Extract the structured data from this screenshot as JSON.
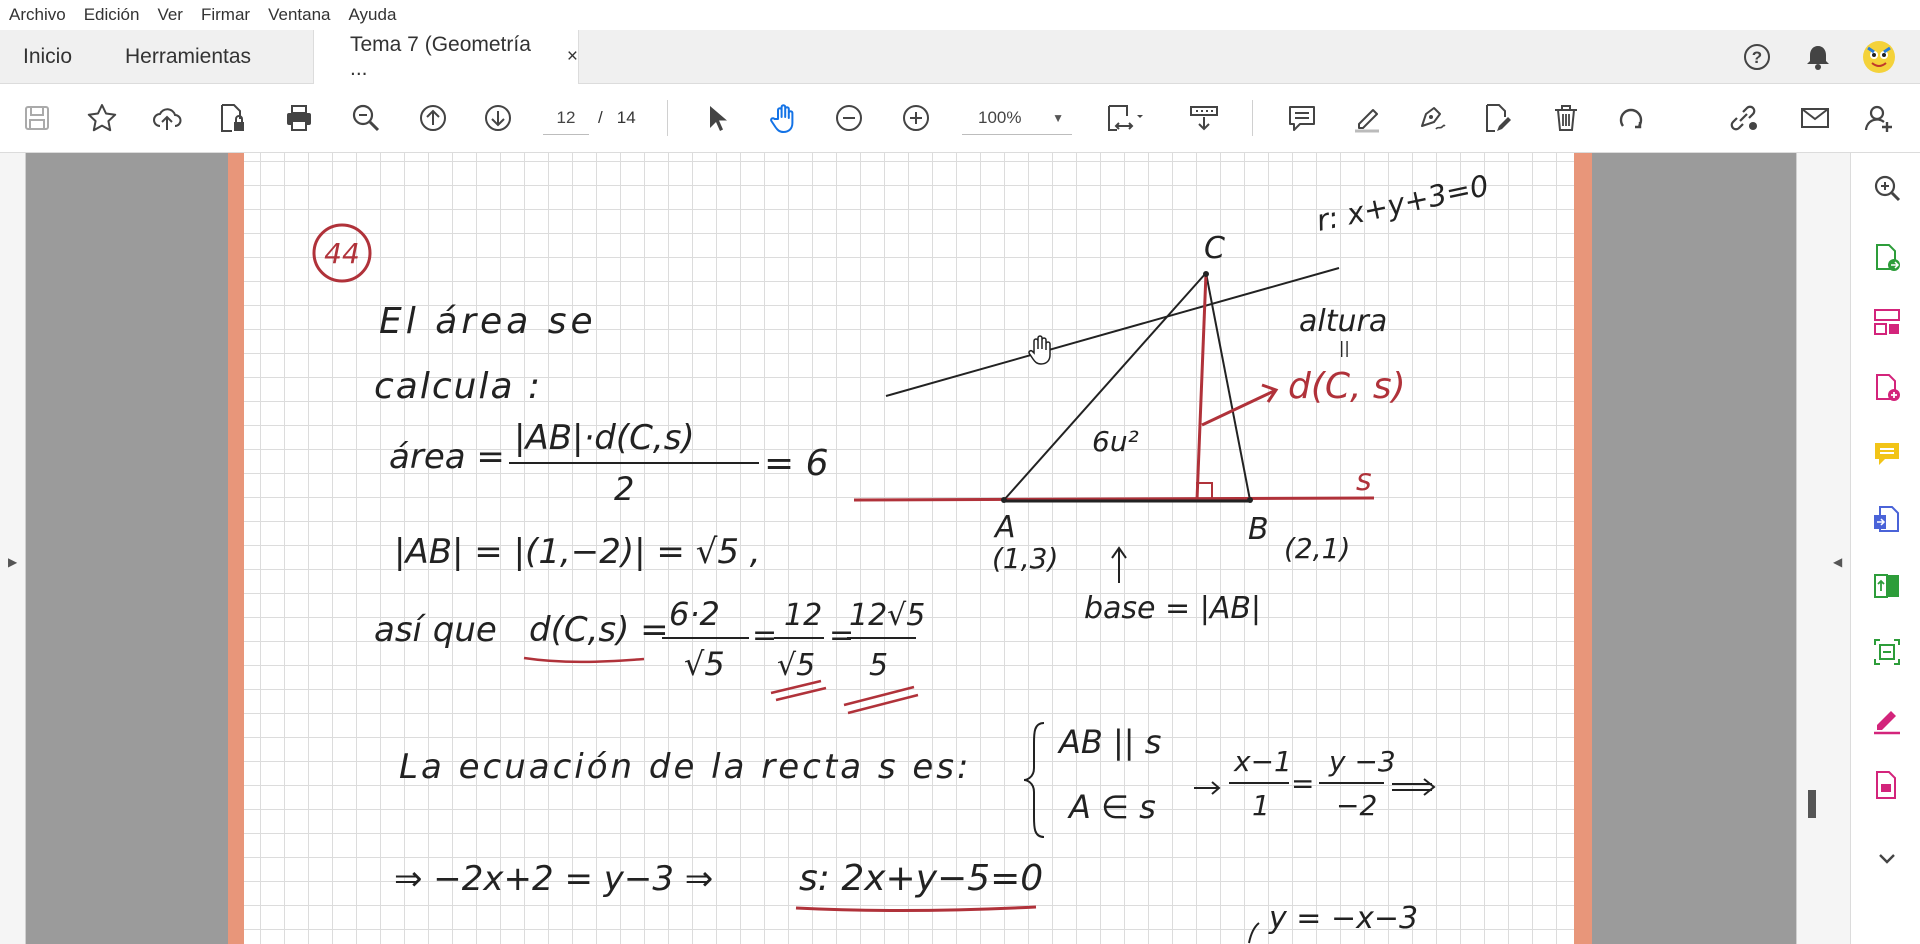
{
  "menu": [
    "Archivo",
    "Edición",
    "Ver",
    "Firmar",
    "Ventana",
    "Ayuda"
  ],
  "tabs": {
    "home": "Inicio",
    "tools": "Herramientas",
    "document": "Tema 7 (Geometría ...",
    "close": "×"
  },
  "toolbar": {
    "page_current": "12",
    "page_separator": "/",
    "page_total": "14",
    "zoom": "100%"
  },
  "colors": {
    "accent_blue": "#1473e6",
    "page_border": "#e8967a",
    "tool_purple": "#d3247b",
    "tool_green": "#2d9d3a"
  },
  "icons": {
    "toolbar": [
      "save-icon",
      "star-icon",
      "upload-cloud-icon",
      "lock-file-icon",
      "print-icon",
      "zoom-search-icon",
      "page-up-icon",
      "page-down-icon",
      "pointer-icon",
      "hand-icon",
      "zoom-out-icon",
      "zoom-in-icon",
      "fit-page-icon",
      "scroll-mode-icon",
      "comment-icon",
      "highlight-icon",
      "sign-icon",
      "edit-file-icon",
      "delete-icon",
      "rotate-icon",
      "link-icon",
      "email-icon",
      "add-user-icon"
    ],
    "right_panel": [
      "search-zoom-icon",
      "export-pdf-icon",
      "organize-pages-icon",
      "create-pdf-icon",
      "comment-tool-icon",
      "combine-files-icon",
      "compress-icon",
      "scan-icon",
      "fill-sign-icon",
      "edit-pdf-icon",
      "more-tools-icon"
    ]
  },
  "document": {
    "exercise_number": "44",
    "line_r": "r: x+y+3=0",
    "vertex_c": "C",
    "vertex_a": "A",
    "vertex_b": "B",
    "coord_a": "(1,3)",
    "coord_b": "(2,1)",
    "line_s": "s",
    "area": "6u²",
    "altura": "altura",
    "equals_sign": "||",
    "distance": "d(C, s)",
    "base": "base = |AB|",
    "text1": "El área se",
    "text2": "calcula :",
    "formula_area_lhs": "área =",
    "formula_area_num": "|AB|·d(C,s)",
    "formula_area_den": "2",
    "formula_area_rhs": "= 6",
    "ab_modulus": "|AB| = |(1,−2)| = √5 ,",
    "asi_que": "así que",
    "dist_lhs": "d(C,s) =",
    "frac1_num": "6·2",
    "frac1_den": "√5",
    "frac2_num": "12",
    "frac2_den": "√5",
    "frac3_num": "12√5",
    "frac3_den": "5",
    "eq_line_text": "La ecuación de la recta s es:",
    "cond1": "AB || s",
    "cond2": "A ∈ s",
    "cont_num1": "x−1",
    "cont_den1": "1",
    "cont_num2": "y −3",
    "cont_den2": "−2",
    "result_line": "⇒ −2x+2 = y−3  ⇒",
    "result_eq": "s: 2x+y−5=0",
    "bottom_eq": "y = −x−3"
  }
}
